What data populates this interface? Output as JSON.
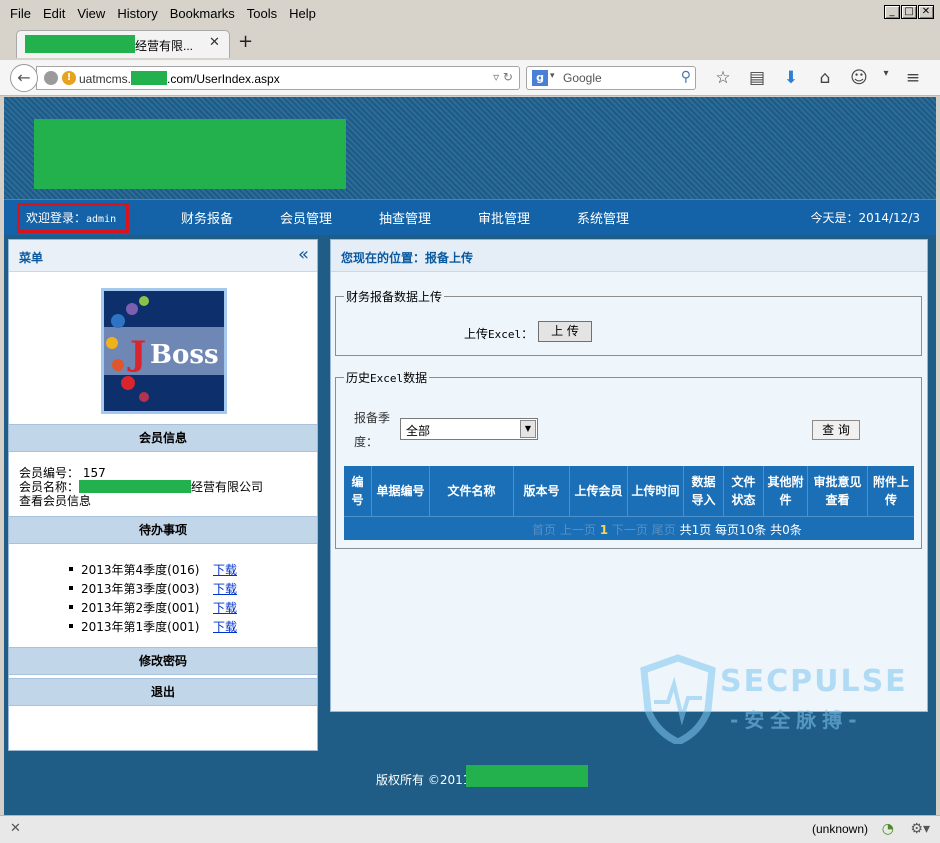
{
  "browser": {
    "menu": [
      "File",
      "Edit",
      "View",
      "History",
      "Bookmarks",
      "Tools",
      "Help"
    ],
    "tab_title": "经营有限...",
    "tab_close": "✕",
    "new_tab": "+",
    "url_prefix": "uatmcms.",
    "url_suffix": ".com/UserIndex.aspx",
    "search_placeholder": "Google",
    "status_text": "(unknown)"
  },
  "nav": {
    "welcome_label": "欢迎登录：",
    "welcome_user": "admin",
    "items": [
      "财务报备",
      "会员管理",
      "抽查管理",
      "审批管理",
      "系统管理"
    ],
    "today": "今天是：2014/12/3"
  },
  "left": {
    "menu_title": "菜单",
    "collapse_glyph": "«",
    "member_info_title": "会员信息",
    "member_no": "会员编号： 157",
    "member_name_label": "会员名称：",
    "member_name_suffix": "经营有限公司",
    "view_member": "查看会员信息",
    "todo_title": "待办事项",
    "todos": [
      {
        "text": "2013年第4季度(016)",
        "link": "下载"
      },
      {
        "text": "2013年第3季度(003)",
        "link": "下载"
      },
      {
        "text": "2013年第2季度(001)",
        "link": "下载"
      },
      {
        "text": "2013年第1季度(001)",
        "link": "下载"
      }
    ],
    "change_password": "修改密码",
    "logout": "退出"
  },
  "right": {
    "breadcrumb": "您现在的位置：报备上传",
    "upload_legend": "财务报备数据上传",
    "upload_label_prefix": "上传",
    "upload_label_mono": "Excel",
    "upload_label_suffix": "：",
    "upload_button": "上 传",
    "history_legend_prefix": "历史",
    "history_legend_mono": "Excel",
    "history_legend_suffix": "数据",
    "quarter_label": "报备季度：",
    "quarter_value": "全部",
    "query_button": "查 询",
    "columns": [
      "编号",
      "单据编号",
      "文件名称",
      "版本号",
      "上传会员",
      "上传时间",
      "数据导入",
      "文件状态",
      "其他附件",
      "审批意见查看",
      "附件上传"
    ],
    "pager": {
      "first": "首页",
      "prev": "上一页",
      "current": "1",
      "next": "下一页",
      "last": "尾页",
      "summary": "共1页 每页10条 共0条"
    }
  },
  "footer": {
    "copyright": "版权所有 ©2011",
    "watermark_en": "SECPULSE",
    "watermark_cn": "-安全脉搏-"
  },
  "colors": {
    "redaction": "#22b14c",
    "nav_blue": "#1463a8",
    "header_blue": "#1f5c86",
    "highlight_red": "#d9131b"
  }
}
